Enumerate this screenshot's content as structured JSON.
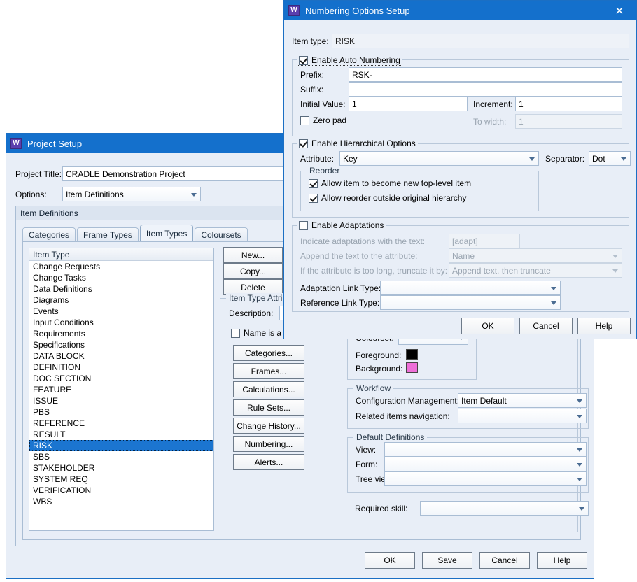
{
  "desktop": {
    "background": "#ffffff"
  },
  "project_setup": {
    "title": "Project Setup",
    "app_icon": "W",
    "project_title_label": "Project Title:",
    "project_title_value": "CRADLE Demonstration Project",
    "options_label": "Options:",
    "options_value": "Item Definitions",
    "panel_header": "Item Definitions",
    "tabs": [
      {
        "label": "Categories",
        "active": false
      },
      {
        "label": "Frame Types",
        "active": false
      },
      {
        "label": "Item Types",
        "active": true
      },
      {
        "label": "Coloursets",
        "active": false
      }
    ],
    "list_header": "Item Type",
    "item_types": [
      {
        "label": "Change Requests",
        "selected": false
      },
      {
        "label": "Change Tasks",
        "selected": false
      },
      {
        "label": "Data Definitions",
        "selected": false
      },
      {
        "label": "Diagrams",
        "selected": false
      },
      {
        "label": "Events",
        "selected": false
      },
      {
        "label": "Input Conditions",
        "selected": false
      },
      {
        "label": "Requirements",
        "selected": false
      },
      {
        "label": "Specifications",
        "selected": false
      },
      {
        "label": "DATA BLOCK",
        "selected": false
      },
      {
        "label": "DEFINITION",
        "selected": false
      },
      {
        "label": "DOC SECTION",
        "selected": false
      },
      {
        "label": "FEATURE",
        "selected": false
      },
      {
        "label": "ISSUE",
        "selected": false
      },
      {
        "label": "PBS",
        "selected": false
      },
      {
        "label": "REFERENCE",
        "selected": false
      },
      {
        "label": "RESULT",
        "selected": false
      },
      {
        "label": "RISK",
        "selected": true
      },
      {
        "label": "SBS",
        "selected": false
      },
      {
        "label": "STAKEHOLDER",
        "selected": false
      },
      {
        "label": "SYSTEM REQ",
        "selected": false
      },
      {
        "label": "VERIFICATION",
        "selected": false
      },
      {
        "label": "WBS",
        "selected": false
      }
    ],
    "list_buttons": [
      {
        "label": "New..."
      },
      {
        "label": "Copy..."
      },
      {
        "label": "Delete"
      }
    ],
    "attributes_group": "Item Type Attributes",
    "description_label": "Description:",
    "description_value": "A risk is",
    "name_mandatory_label": "Name is a manda",
    "attribute_buttons": [
      {
        "label": "Categories..."
      },
      {
        "label": "Frames..."
      },
      {
        "label": "Calculations..."
      },
      {
        "label": "Rule Sets..."
      },
      {
        "label": "Change History..."
      },
      {
        "label": "Numbering..."
      },
      {
        "label": "Alerts..."
      }
    ],
    "colourset_label": "Colourset:",
    "colourset_value": "",
    "foreground_label": "Foreground:",
    "foreground_colour": "#000000",
    "background_label": "Background:",
    "background_colour": "#ee6fd8",
    "workflow_group": "Workflow",
    "config_mgmt_label": "Configuration Management:",
    "config_mgmt_value": "Item Default",
    "related_nav_label": "Related items navigation:",
    "related_nav_value": "",
    "default_defs_group": "Default Definitions",
    "view_label": "View:",
    "view_value": "",
    "form_label": "Form:",
    "form_value": "",
    "tree_view_label": "Tree view:",
    "tree_view_value": "",
    "required_skill_label": "Required skill:",
    "required_skill_value": "",
    "footer_buttons": [
      {
        "label": "OK"
      },
      {
        "label": "Save"
      },
      {
        "label": "Cancel"
      },
      {
        "label": "Help"
      }
    ]
  },
  "numbering_dialog": {
    "title": "Numbering Options Setup",
    "app_icon": "W",
    "close_icon": "✕",
    "item_type_label": "Item type:",
    "item_type_value": "RISK",
    "auto_numbering": {
      "group_label": "Enable Auto Numbering",
      "checked": true,
      "prefix_label": "Prefix:",
      "prefix_value": "RSK-",
      "suffix_label": "Suffix:",
      "suffix_value": "",
      "initial_value_label": "Initial Value:",
      "initial_value": "1",
      "increment_label": "Increment:",
      "increment_value": "1",
      "zero_pad_label": "Zero pad",
      "zero_pad_checked": false,
      "to_width_label": "To width:",
      "to_width_value": "1"
    },
    "hierarchical": {
      "group_label": "Enable Hierarchical Options",
      "checked": true,
      "attribute_label": "Attribute:",
      "attribute_value": "Key",
      "separator_label": "Separator:",
      "separator_value": "Dot",
      "reorder_group": "Reorder",
      "allow_top_level_label": "Allow item to become new top-level item",
      "allow_top_level_checked": true,
      "allow_outside_label": "Allow reorder outside original hierarchy",
      "allow_outside_checked": true
    },
    "adaptations": {
      "group_label": "Enable Adaptations",
      "checked": false,
      "indicate_label": "Indicate adaptations with the text:",
      "indicate_value": "[adapt]",
      "append_label": "Append the text to the attribute:",
      "append_value": "Name",
      "truncate_label": "If the attribute is too long, truncate it by:",
      "truncate_value": "Append text, then truncate",
      "adaptation_link_label": "Adaptation Link Type:",
      "adaptation_link_value": "",
      "reference_link_label": "Reference Link Type:",
      "reference_link_value": ""
    },
    "footer_buttons": [
      {
        "label": "OK"
      },
      {
        "label": "Cancel"
      },
      {
        "label": "Help"
      }
    ]
  }
}
